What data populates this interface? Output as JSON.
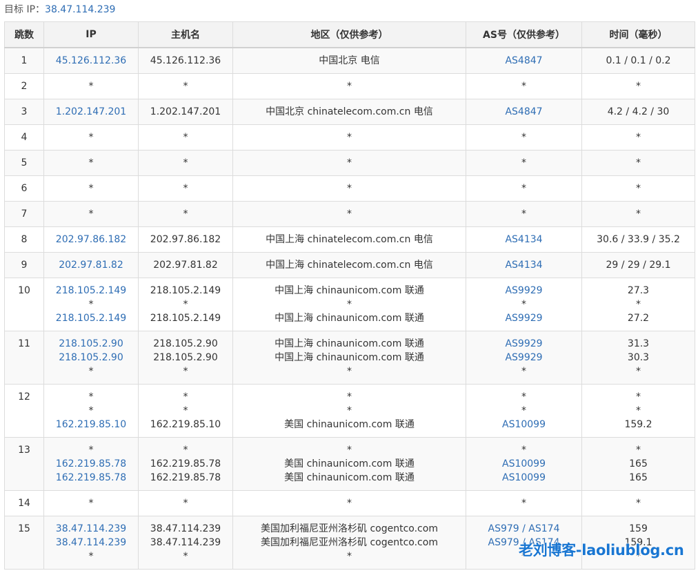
{
  "target": {
    "label": "目标 IP：",
    "ip": "38.47.114.239"
  },
  "columns": [
    "跳数",
    "IP",
    "主机名",
    "地区（仅供参考）",
    "AS号（仅供参考）",
    "时间（毫秒）"
  ],
  "hops": [
    {
      "hop": "1",
      "lines": [
        {
          "ip": "45.126.112.36",
          "host": "45.126.112.36",
          "region": "中国北京 电信",
          "as": "AS4847",
          "time": "0.1 / 0.1 / 0.2"
        }
      ]
    },
    {
      "hop": "2",
      "lines": [
        {
          "ip": "*",
          "host": "*",
          "region": "*",
          "as": "*",
          "time": "*"
        }
      ]
    },
    {
      "hop": "3",
      "lines": [
        {
          "ip": "1.202.147.201",
          "host": "1.202.147.201",
          "region": "中国北京 chinatelecom.com.cn 电信",
          "as": "AS4847",
          "time": "4.2 / 4.2 / 30"
        }
      ]
    },
    {
      "hop": "4",
      "lines": [
        {
          "ip": "*",
          "host": "*",
          "region": "*",
          "as": "*",
          "time": "*"
        }
      ]
    },
    {
      "hop": "5",
      "lines": [
        {
          "ip": "*",
          "host": "*",
          "region": "*",
          "as": "*",
          "time": "*"
        }
      ]
    },
    {
      "hop": "6",
      "lines": [
        {
          "ip": "*",
          "host": "*",
          "region": "*",
          "as": "*",
          "time": "*"
        }
      ]
    },
    {
      "hop": "7",
      "lines": [
        {
          "ip": "*",
          "host": "*",
          "region": "*",
          "as": "*",
          "time": "*"
        }
      ]
    },
    {
      "hop": "8",
      "lines": [
        {
          "ip": "202.97.86.182",
          "host": "202.97.86.182",
          "region": "中国上海 chinatelecom.com.cn 电信",
          "as": "AS4134",
          "time": "30.6 / 33.9 / 35.2"
        }
      ]
    },
    {
      "hop": "9",
      "lines": [
        {
          "ip": "202.97.81.82",
          "host": "202.97.81.82",
          "region": "中国上海 chinatelecom.com.cn 电信",
          "as": "AS4134",
          "time": "29 / 29 / 29.1"
        }
      ]
    },
    {
      "hop": "10",
      "lines": [
        {
          "ip": "218.105.2.149",
          "host": "218.105.2.149",
          "region": "中国上海 chinaunicom.com 联通",
          "as": "AS9929",
          "time": "27.3"
        },
        {
          "ip": "*",
          "host": "*",
          "region": "*",
          "as": "*",
          "time": "*"
        },
        {
          "ip": "218.105.2.149",
          "host": "218.105.2.149",
          "region": "中国上海 chinaunicom.com 联通",
          "as": "AS9929",
          "time": "27.2"
        }
      ]
    },
    {
      "hop": "11",
      "lines": [
        {
          "ip": "218.105.2.90",
          "host": "218.105.2.90",
          "region": "中国上海 chinaunicom.com 联通",
          "as": "AS9929",
          "time": "31.3"
        },
        {
          "ip": "218.105.2.90",
          "host": "218.105.2.90",
          "region": "中国上海 chinaunicom.com 联通",
          "as": "AS9929",
          "time": "30.3"
        },
        {
          "ip": "*",
          "host": "*",
          "region": "*",
          "as": "*",
          "time": "*"
        }
      ]
    },
    {
      "hop": "12",
      "lines": [
        {
          "ip": "*",
          "host": "*",
          "region": "*",
          "as": "*",
          "time": "*"
        },
        {
          "ip": "*",
          "host": "*",
          "region": "*",
          "as": "*",
          "time": "*"
        },
        {
          "ip": "162.219.85.10",
          "host": "162.219.85.10",
          "region": "美国 chinaunicom.com 联通",
          "as": "AS10099",
          "time": "159.2"
        }
      ]
    },
    {
      "hop": "13",
      "lines": [
        {
          "ip": "*",
          "host": "*",
          "region": "*",
          "as": "*",
          "time": "*"
        },
        {
          "ip": "162.219.85.78",
          "host": "162.219.85.78",
          "region": "美国 chinaunicom.com 联通",
          "as": "AS10099",
          "time": "165"
        },
        {
          "ip": "162.219.85.78",
          "host": "162.219.85.78",
          "region": "美国 chinaunicom.com 联通",
          "as": "AS10099",
          "time": "165"
        }
      ]
    },
    {
      "hop": "14",
      "lines": [
        {
          "ip": "*",
          "host": "*",
          "region": "*",
          "as": "*",
          "time": "*"
        }
      ]
    },
    {
      "hop": "15",
      "lines": [
        {
          "ip": "38.47.114.239",
          "host": "38.47.114.239",
          "region": "美国加利福尼亚州洛杉矶 cogentco.com",
          "as": "AS979 / AS174",
          "time": "159"
        },
        {
          "ip": "38.47.114.239",
          "host": "38.47.114.239",
          "region": "美国加利福尼亚州洛杉矶 cogentco.com",
          "as": "AS979 / AS174",
          "time": "159.1"
        },
        {
          "ip": "*",
          "host": "*",
          "region": "*",
          "as": "*",
          "time": "*"
        }
      ]
    }
  ],
  "watermark": "老刘博客-laoliublog.cn",
  "colors": {
    "link": "#2e6db4",
    "watermark": "#1976d2",
    "header_bg": "#f3f3f3",
    "border": "#dcdcdc"
  }
}
